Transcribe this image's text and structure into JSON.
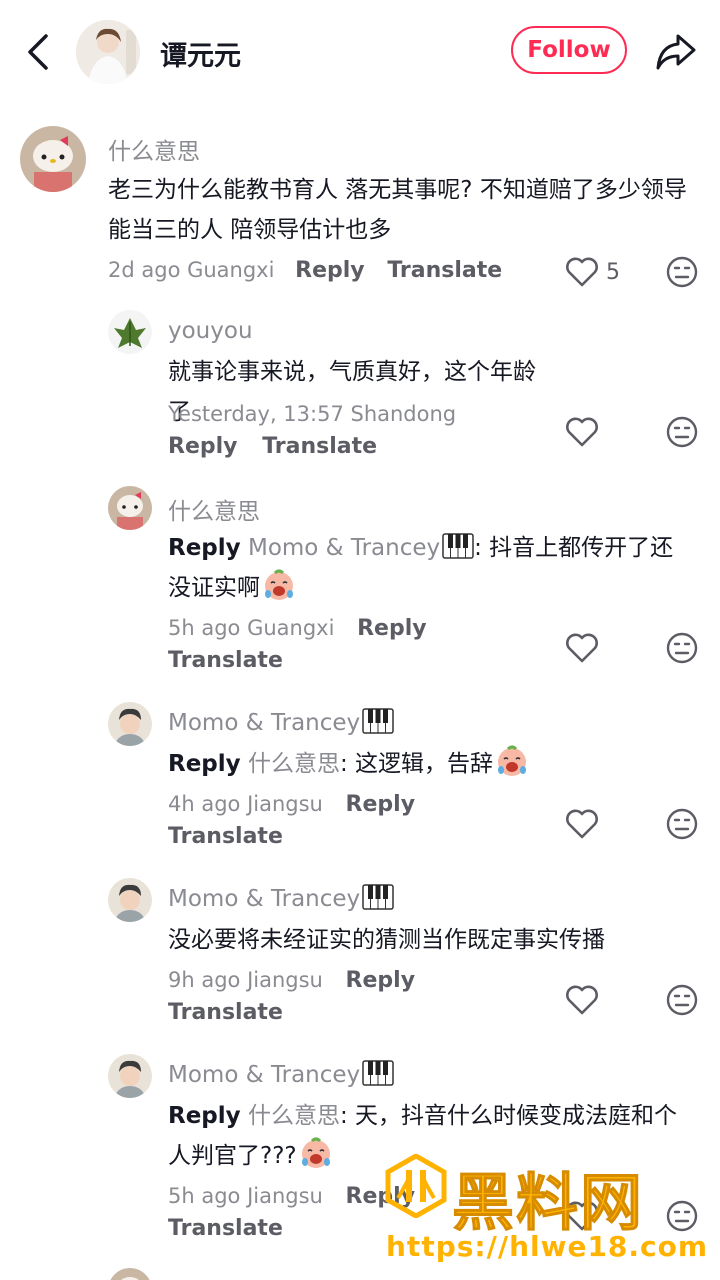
{
  "header": {
    "back_icon": "chevron-left-icon",
    "name": "谭元元",
    "follow_label": "Follow",
    "share_icon": "share-arrow-icon"
  },
  "comments": [
    {
      "username": "什么意思",
      "text": "老三为什么能教书育人 落无其事呢? 不知道赔了多少领导能当三的人 陪领导估计也多",
      "meta": "2d ago Guangxi",
      "reply_label": "Reply",
      "translate_label": "Translate",
      "likes": "5"
    },
    {
      "username": "youyou",
      "text": "就事论事来说，气质真好，这个年龄了",
      "meta": "Yesterday, 13:57 Shandong",
      "reply_label": "Reply",
      "translate_label": "Translate"
    },
    {
      "username": "什么意思",
      "reply_prefix": "Reply",
      "reply_target": "Momo & Trancey",
      "text": ": 抖音上都传开了还没证实啊",
      "meta": "5h ago Guangxi",
      "reply_label": "Reply",
      "translate_label": "Translate"
    },
    {
      "username": "Momo & Trancey",
      "reply_prefix": "Reply",
      "reply_target": "什么意思",
      "text": ": 这逻辑，告辞",
      "meta": "4h ago Jiangsu",
      "reply_label": "Reply",
      "translate_label": "Translate"
    },
    {
      "username": "Momo & Trancey",
      "text": "没必要将未经证实的猜测当作既定事实传播",
      "meta": "9h ago Jiangsu",
      "reply_label": "Reply",
      "translate_label": "Translate"
    },
    {
      "username": "Momo & Trancey",
      "reply_prefix": "Reply",
      "reply_target": "什么意思",
      "text": ": 天，抖音什么时候变成法庭和个人判官了???",
      "meta": "5h ago Jiangsu",
      "reply_label": "Reply",
      "translate_label": "Translate"
    }
  ],
  "watermark": {
    "title": "黑料网",
    "url": "https://hlwe18.com"
  },
  "colors": {
    "accent": "#fe2c55",
    "muted_text": "#8a8b91",
    "watermark": "#ffb300"
  }
}
